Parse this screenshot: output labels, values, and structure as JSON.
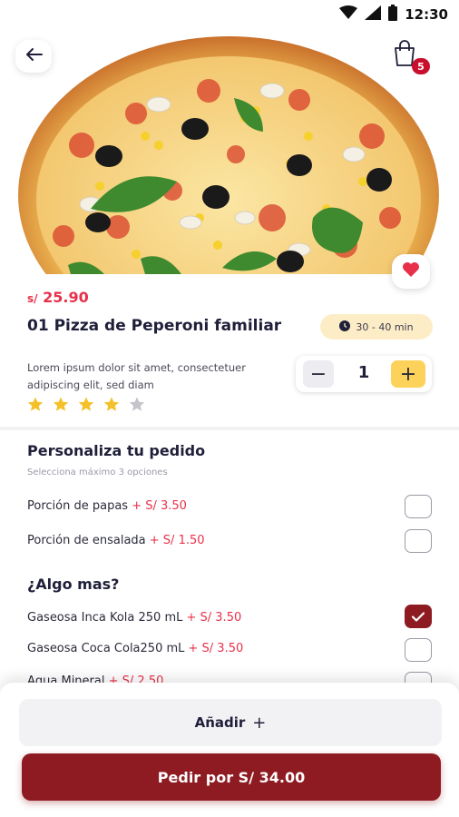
{
  "status_bar": {
    "time": "12:30"
  },
  "header": {
    "cart_count": "5"
  },
  "product": {
    "currency": "s/",
    "price": "25.90",
    "title": "01 Pizza de Peperoni familiar",
    "time": "30 - 40 min",
    "description": "Lorem ipsum dolor sit amet, consectetuer adipiscing elit, sed diam",
    "rating": 4,
    "rating_max": 5,
    "quantity": "1",
    "minus_label": "−",
    "plus_label": "+"
  },
  "customize": {
    "title": "Personaliza tu pedido",
    "subtitle": "Selecciona máximo 3 opciones",
    "options": [
      {
        "label": "Porción de papas",
        "price": "+ S/ 3.50",
        "checked": false
      },
      {
        "label": "Porción de ensalada",
        "price": "+ S/ 1.50",
        "checked": false
      }
    ]
  },
  "extras": {
    "title": "¿Algo mas?",
    "options": [
      {
        "label": "Gaseosa Inca Kola 250 mL",
        "price": "+ S/ 3.50",
        "checked": true
      },
      {
        "label": "Gaseosa Coca Cola250 mL",
        "price": "+ S/ 3.50",
        "checked": false
      },
      {
        "label": "Agua Mineral",
        "price": "+ S/ 2.50",
        "checked": false
      }
    ]
  },
  "actions": {
    "add_label": "Añadir",
    "add_icon": "+",
    "order_label": "Pedir por S/ 34.00"
  },
  "colors": {
    "accent": "#8e1b22",
    "price": "#e8304a",
    "star": "#f4c12a",
    "star_off": "#c4c4cc",
    "plus_button": "#fcd25a",
    "time_pill": "#fdedc7"
  }
}
